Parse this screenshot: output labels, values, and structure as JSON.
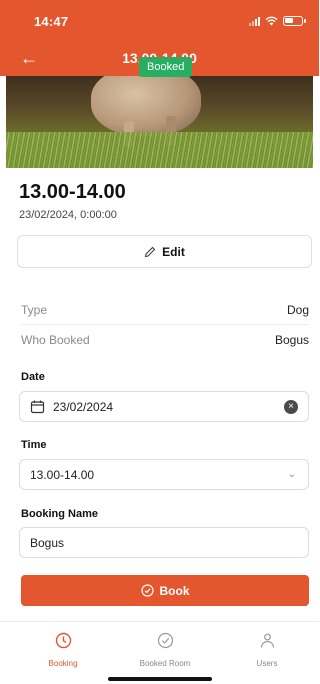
{
  "status_bar": {
    "time": "14:47"
  },
  "nav": {
    "title": "13.00-14.00"
  },
  "badge": {
    "label": "Booked"
  },
  "booking": {
    "title": "13.00-14.00",
    "subtitle": "23/02/2024, 0:00:00"
  },
  "edit_button": {
    "label": "Edit"
  },
  "info": [
    {
      "key": "Type",
      "value": "Dog"
    },
    {
      "key": "Who Booked",
      "value": "Bogus"
    }
  ],
  "form": {
    "date": {
      "label": "Date",
      "value": "23/02/2024"
    },
    "time": {
      "label": "Time",
      "value": "13.00-14.00"
    },
    "booking_name": {
      "label": "Booking Name",
      "value": "Bogus"
    }
  },
  "book_button": {
    "label": "Book"
  },
  "tabs": [
    {
      "label": "Booking",
      "icon": "clock-icon",
      "active": true
    },
    {
      "label": "Booked Room",
      "icon": "check-circle-icon",
      "active": false
    },
    {
      "label": "Users",
      "icon": "user-icon",
      "active": false
    }
  ],
  "colors": {
    "accent": "#e4572e",
    "badge": "#27ae60"
  }
}
